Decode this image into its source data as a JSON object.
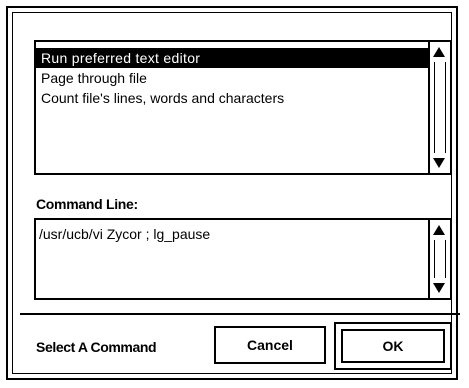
{
  "command_list": {
    "items": [
      {
        "label": "Run preferred text editor",
        "selected": true
      },
      {
        "label": "Page through file",
        "selected": false
      },
      {
        "label": "Count file's lines, words and characters",
        "selected": false
      }
    ]
  },
  "command_line": {
    "label": "Command Line:",
    "value": "/usr/ucb/vi Zycor ; lg_pause"
  },
  "footer": {
    "status": "Select A Command",
    "cancel_label": "Cancel",
    "ok_label": "OK"
  },
  "icons": {
    "scroll_up": "scroll-up-arrow-icon",
    "scroll_down": "scroll-down-arrow-icon"
  },
  "colors": {
    "selection_bg": "#000000",
    "selection_fg": "#ffffff"
  }
}
